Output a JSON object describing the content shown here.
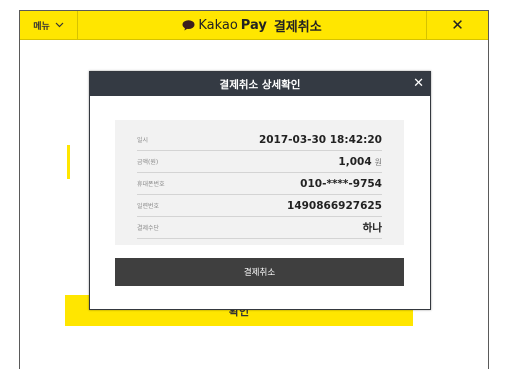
{
  "topbar": {
    "menu_label": "메뉴",
    "brand_kakao": "Kakao",
    "brand_pay": "Pay",
    "title": "결제취소",
    "close_symbol": "✕"
  },
  "background": {
    "confirm_label": "확인"
  },
  "modal": {
    "title": "결제취소 상세확인",
    "close_symbol": "✕",
    "rows": [
      {
        "label": "일시",
        "value": "2017-03-30 18:42:20",
        "unit": ""
      },
      {
        "label": "금액(원)",
        "value": "1,004",
        "unit": "원"
      },
      {
        "label": "휴대폰번호",
        "value": "010-****-9754",
        "unit": ""
      },
      {
        "label": "일련번호",
        "value": "1490866927625",
        "unit": ""
      },
      {
        "label": "결제수단",
        "value": "하나",
        "unit": ""
      }
    ],
    "cancel_button_label": "결제취소"
  },
  "colors": {
    "brand_yellow": "#ffe600",
    "modal_header": "#343a43",
    "cancel_button": "#3f3f3f"
  },
  "icons": {
    "menu_chevron": "chevron-down-icon",
    "brand_speech": "kakao-speech-bubble-icon"
  }
}
